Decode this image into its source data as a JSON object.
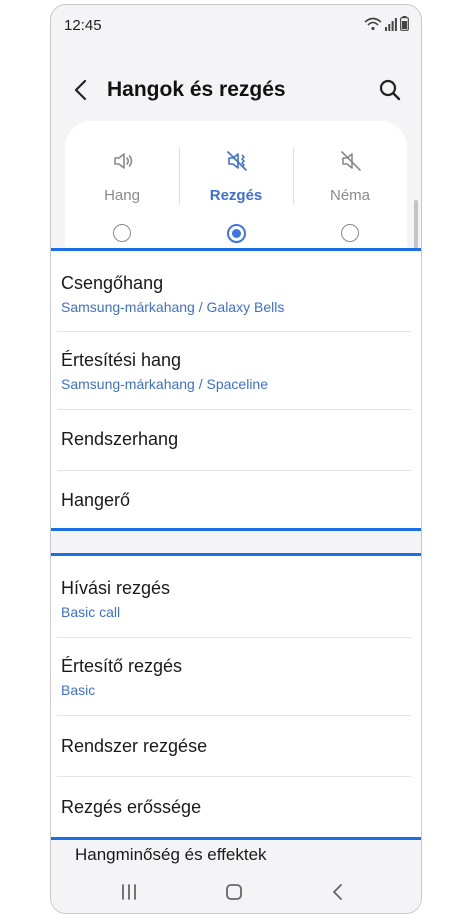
{
  "status_bar": {
    "time": "12:45"
  },
  "header": {
    "title": "Hangok és rezgés"
  },
  "modes": [
    {
      "label": "Hang",
      "icon": "speaker-icon",
      "selected": false
    },
    {
      "label": "Rezgés",
      "icon": "vibrate-icon",
      "selected": true
    },
    {
      "label": "Néma",
      "icon": "mute-icon",
      "selected": false
    }
  ],
  "group1": {
    "items": [
      {
        "label": "Csengőhang",
        "sub": "Samsung-márkahang / Galaxy Bells"
      },
      {
        "label": "Értesítési hang",
        "sub": "Samsung-márkahang / Spaceline"
      },
      {
        "label": "Rendszerhang"
      },
      {
        "label": "Hangerő"
      }
    ]
  },
  "group2": {
    "items": [
      {
        "label": "Hívási rezgés",
        "sub": "Basic call"
      },
      {
        "label": "Értesítő rezgés",
        "sub": "Basic"
      },
      {
        "label": "Rendszer rezgése"
      },
      {
        "label": "Rezgés erőssége"
      }
    ]
  },
  "partial_item": "Hangminőség és effektek",
  "colors": {
    "highlight": "#1a6fe6",
    "accent": "#3e6fd2",
    "background": "#f4f4f6"
  }
}
